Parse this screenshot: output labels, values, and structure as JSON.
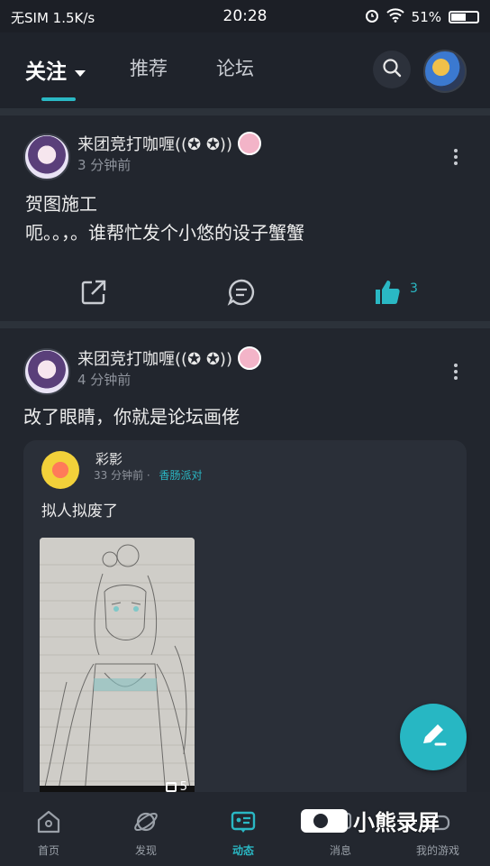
{
  "status_bar": {
    "carrier": "无SIM 1.5K/s",
    "time": "20:28",
    "battery": "51%"
  },
  "header": {
    "tabs": [
      {
        "label": "关注"
      },
      {
        "label": "推荐"
      },
      {
        "label": "论坛"
      }
    ]
  },
  "posts": [
    {
      "username": "来团竞打咖喱((✪ ✪))",
      "time": "3 分钟前",
      "lines": [
        "贺图施工",
        "呃。。，。谁帮忙发个小悠的设子蟹蟹"
      ],
      "likes": "3"
    },
    {
      "username": "来团竞打咖喱((✪ ✪))",
      "time": "4 分钟前",
      "text": "改了眼睛，你就是论坛画佬",
      "repost": {
        "username": "彩影",
        "time": "33 分钟前",
        "tag": "香肠派对",
        "text": "拟人拟废了",
        "image_count": "5"
      }
    }
  ],
  "bottom_nav": [
    {
      "label": "首页"
    },
    {
      "label": "发现"
    },
    {
      "label": "动态"
    },
    {
      "label": "消息"
    },
    {
      "label": "我的游戏"
    }
  ],
  "watermark": "小熊录屏",
  "colors": {
    "accent": "#2ab8c4",
    "background": "#1c1f26",
    "card": "#22262e"
  }
}
